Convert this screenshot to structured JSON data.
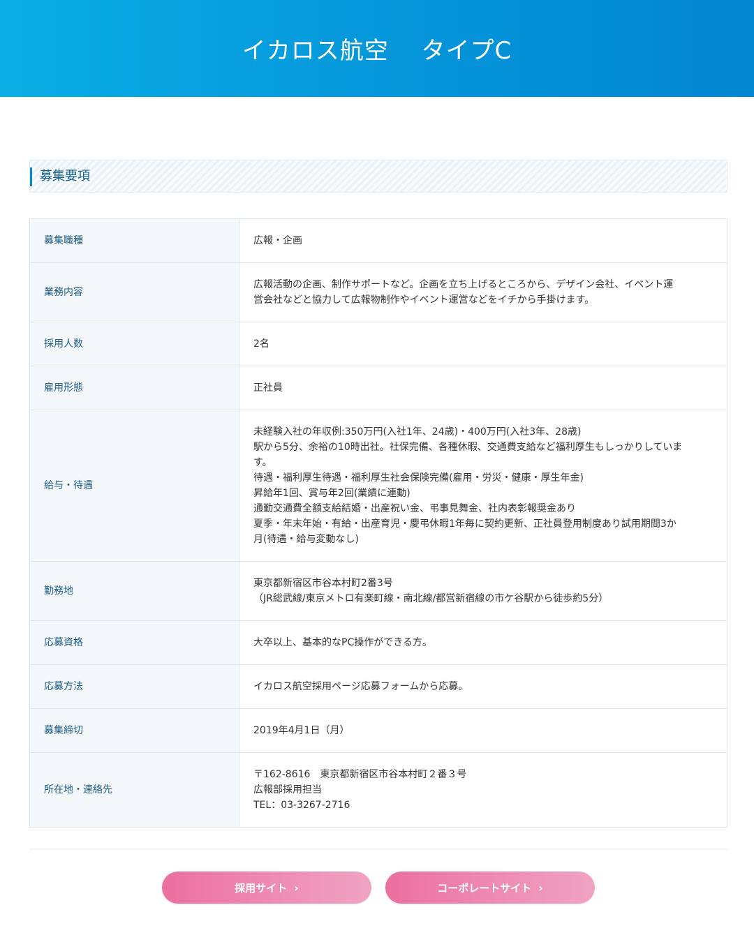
{
  "header": {
    "title": "イカロス航空　 タイプC"
  },
  "section": {
    "title": "募集要項"
  },
  "rows": [
    {
      "label": "募集職種",
      "lines": [
        "広報・企画"
      ]
    },
    {
      "label": "業務内容",
      "lines": [
        "広報活動の企画、制作サポートなど。企画を立ち上げるところから、デザイン会社、イベント運",
        "営会社などと協力して広報物制作やイベント運営などをイチから手掛けます。"
      ]
    },
    {
      "label": "採用人数",
      "lines": [
        "2名"
      ]
    },
    {
      "label": "雇用形態",
      "lines": [
        "正社員"
      ]
    },
    {
      "label": "給与・待遇",
      "lines": [
        "未経験入社の年収例:350万円(入社1年、24歳)・400万円(入社3年、28歳)",
        "駅から5分、余裕の10時出社。社保完備、各種休暇、交通費支給など福利厚生もしっかりしていま",
        "す。",
        "待遇・福利厚生待遇・福利厚生社会保険完備(雇用・労災・健康・厚生年金)",
        "昇給年1回、賞与年2回(業績に連動)",
        "通勤交通費全額支給結婚・出産祝い金、弔事見舞金、社内表彰報奨金あり",
        "夏季・年末年始・有給・出産育児・慶弔休暇1年毎に契約更新、正社員登用制度あり試用期間3か",
        "月(待遇・給与変動なし)"
      ]
    },
    {
      "label": "勤務地",
      "lines": [
        "東京都新宿区市谷本村町2番3号",
        "（JR総武線/東京メトロ有楽町線・南北線/都営新宿線の市ケ谷駅から徒歩約5分）"
      ]
    },
    {
      "label": "応募資格",
      "lines": [
        "大卒以上、基本的なPC操作ができる方。"
      ]
    },
    {
      "label": "応募方法",
      "lines": [
        "イカロス航空採用ページ応募フォームから応募。"
      ]
    },
    {
      "label": "募集締切",
      "lines": [
        "2019年4月1日（月）"
      ]
    },
    {
      "label": "所在地・連絡先",
      "lines": [
        "〒162-8616　東京都新宿区市谷本村町２番３号",
        "広報部採用担当",
        "TEL：03-3267-2716"
      ]
    }
  ],
  "buttons": {
    "recruit": {
      "label": "採用サイト",
      "chevron": "›"
    },
    "corporate": {
      "label": "コーポレートサイト",
      "chevron": "›"
    }
  },
  "colors": {
    "header_start": "#0aaee5",
    "header_end": "#0286d0",
    "accent": "#0a86c8",
    "button_start": "#ec6fa0",
    "button_end": "#f0a4c1"
  }
}
